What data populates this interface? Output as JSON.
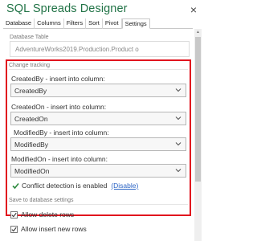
{
  "app": {
    "title": "SQL Spreads Designer",
    "close_glyph": "×"
  },
  "tabs": [
    {
      "label": "Database",
      "active": false
    },
    {
      "label": "Columns",
      "active": false
    },
    {
      "label": "Filters",
      "active": false
    },
    {
      "label": "Sort",
      "active": false
    },
    {
      "label": "Pivot",
      "active": false
    },
    {
      "label": "Settings",
      "active": true
    }
  ],
  "database_table": {
    "section_label": "Database Table",
    "value": "AdventureWorks2019.Production.Product  o"
  },
  "change_tracking": {
    "section_label": "Change tracking",
    "highlight_color": "#e1141e",
    "fields": [
      {
        "label": "CreatedBy - insert into column:",
        "value": "CreatedBy"
      },
      {
        "label": "CreatedOn - insert into column:",
        "value": "CreatedOn"
      },
      {
        "label": "ModifiedBy - insert into column:",
        "value": "ModifiedBy"
      },
      {
        "label": "ModifiedOn - insert into column:",
        "value": "ModifiedOn"
      }
    ],
    "conflict_text": "Conflict detection is enabled",
    "disable_link": "(Disable)",
    "check_color": "#2e8b3f"
  },
  "save_settings": {
    "section_label": "Save to database settings",
    "options": [
      {
        "label": "Allow delete rows",
        "checked": true
      },
      {
        "label": "Allow insert new rows",
        "checked": true
      }
    ]
  },
  "scrollbar": {
    "up_glyph": "▲"
  }
}
